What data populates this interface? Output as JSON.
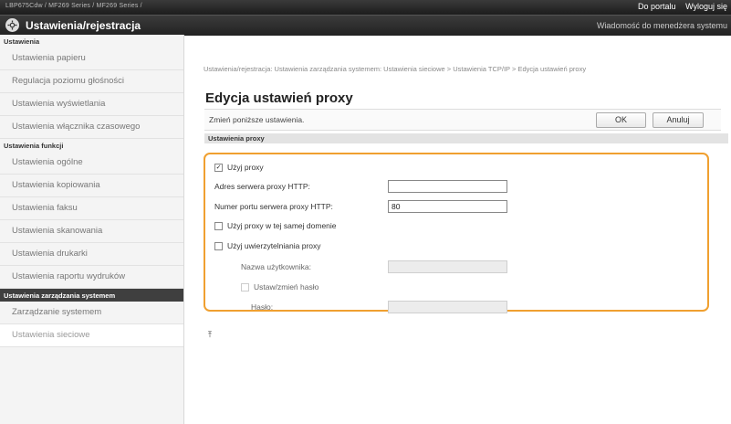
{
  "topbar": {
    "product": "LBP675Cdw / MF269 Series / MF269 Series /",
    "portal_link": "Do portalu",
    "logout_link": "Wyloguj się"
  },
  "titlebar": {
    "title": "Ustawienia/rejestracja",
    "admin_message": "Wiadomość do menedżera systemu"
  },
  "sidebar": {
    "sections": [
      {
        "title": "Ustawienia",
        "dark": false,
        "items": [
          "Ustawienia papieru",
          "Regulacja poziomu głośności",
          "Ustawienia wyświetlania",
          "Ustawienia włącznika czasowego"
        ]
      },
      {
        "title": "Ustawienia funkcji",
        "dark": false,
        "items": [
          "Ustawienia ogólne",
          "Ustawienia kopiowania",
          "Ustawienia faksu",
          "Ustawienia skanowania",
          "Ustawienia drukarki",
          "Ustawienia raportu wydruków"
        ]
      },
      {
        "title": "Ustawienia zarządzania systemem",
        "dark": true,
        "items": [
          "Zarządzanie systemem",
          "Ustawienia sieciowe"
        ]
      }
    ],
    "active_item": "Ustawienia sieciowe"
  },
  "main": {
    "breadcrumb": "Ustawienia/rejestracja: Ustawienia zarządzania systemem: Ustawienia sieciowe > Ustawienia TCP/IP > Edycja ustawień proxy",
    "page_title": "Edycja ustawień proxy",
    "instruction": "Zmień poniższe ustawienia.",
    "ok_label": "OK",
    "cancel_label": "Anuluj",
    "section_title": "Ustawienia proxy",
    "use_proxy_label": "Użyj proxy",
    "use_proxy_checked": true,
    "http_server_label": "Adres serwera proxy HTTP:",
    "http_server_value": "",
    "http_port_label": "Numer portu serwera proxy HTTP:",
    "http_port_value": "80",
    "same_domain_label": "Użyj proxy w tej samej domenie",
    "same_domain_checked": false,
    "auth_label": "Użyj uwierzytelniania proxy",
    "auth_checked": false,
    "username_label": "Nazwa użytkownika:",
    "username_value": "",
    "set_password_label": "Ustaw/zmień hasło",
    "set_password_checked": false,
    "password_label": "Hasło:",
    "password_value": "",
    "accent_color": "#f0a030"
  }
}
